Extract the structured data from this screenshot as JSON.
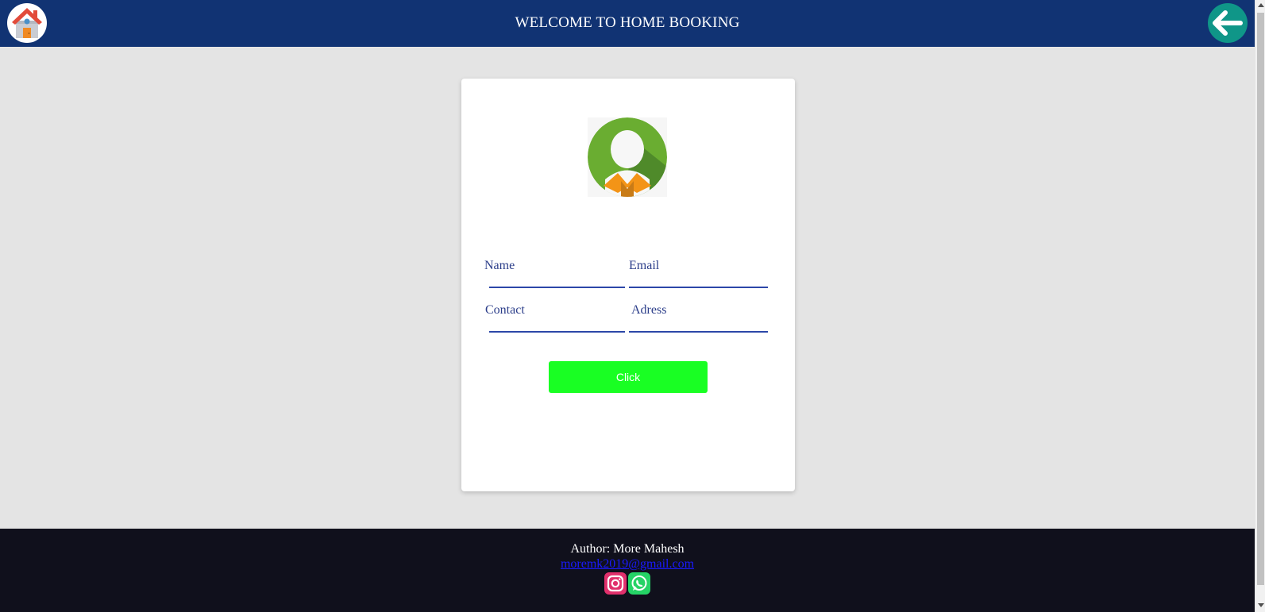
{
  "header": {
    "title": "WELCOME TO HOME BOOKING",
    "home_icon": "home-icon",
    "back_icon": "arrow-left-icon"
  },
  "form": {
    "avatar_icon": "user-avatar-icon",
    "fields": [
      {
        "label": "Name",
        "value": ""
      },
      {
        "label": "Email",
        "value": ""
      },
      {
        "label": "Contact",
        "value": ""
      },
      {
        "label": "Adress",
        "value": ""
      }
    ],
    "submit_label": "Click"
  },
  "footer": {
    "author": "Author: More Mahesh",
    "email": "moremk2019@gmail.com",
    "social": [
      "instagram-icon",
      "whatsapp-icon"
    ]
  },
  "colors": {
    "header_bg": "#113373",
    "page_bg": "#e4e4e4",
    "button_bg": "#19ff23",
    "footer_bg": "#10101c",
    "field_line": "#2c47a8",
    "back_button": "#0f9688"
  }
}
